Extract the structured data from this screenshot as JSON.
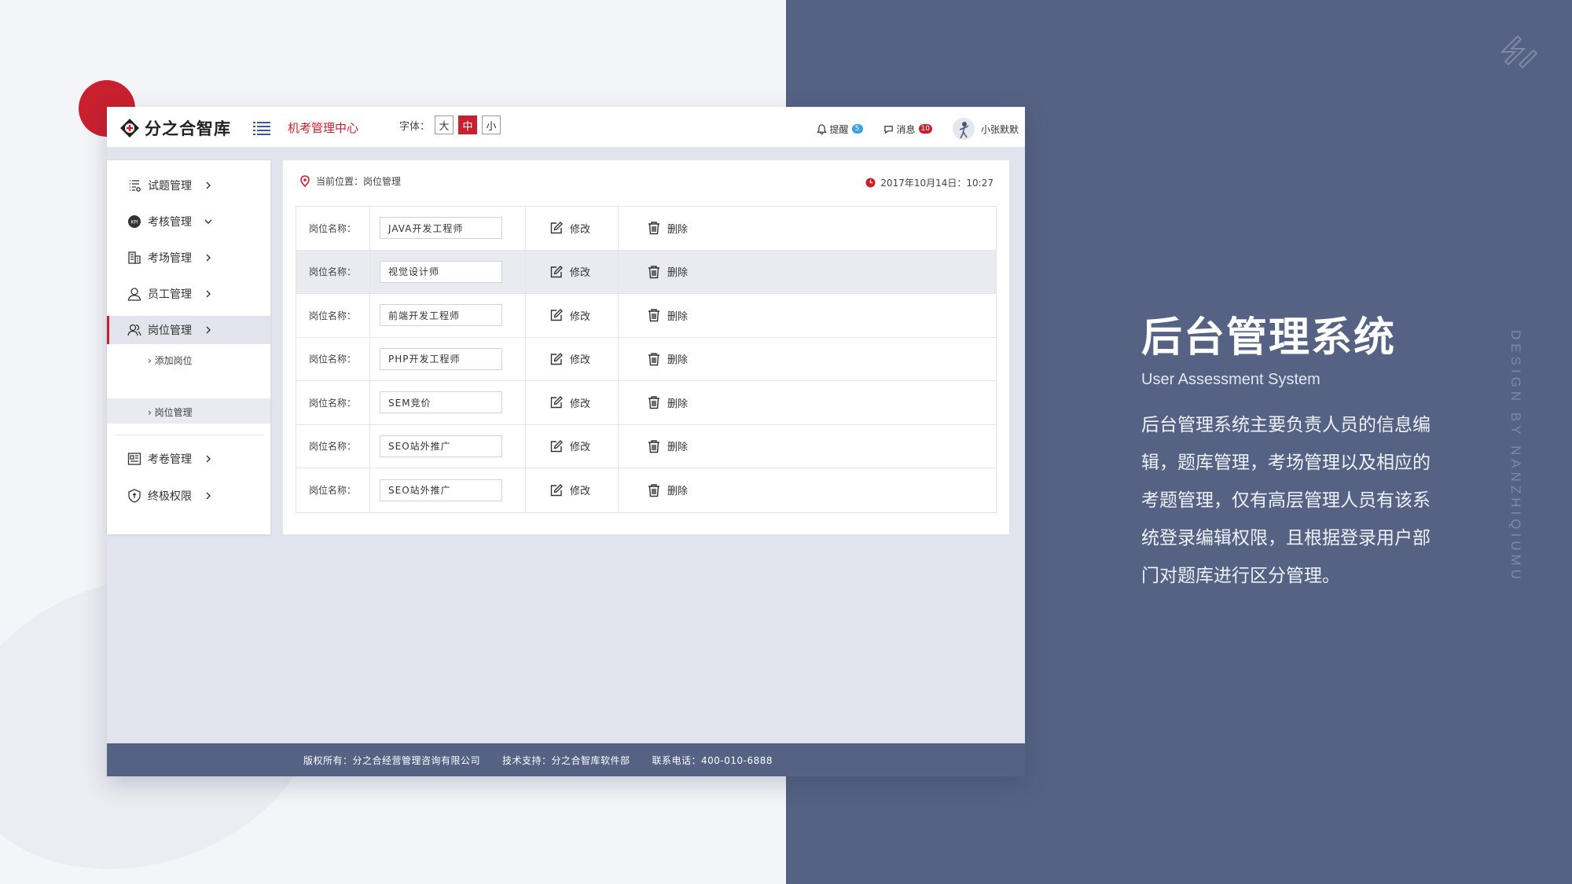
{
  "brand": {
    "name": "分之合智库"
  },
  "header": {
    "app_title": "机考管理中心",
    "font_label": "字体：",
    "font_sizes": [
      "大",
      "中",
      "小"
    ],
    "font_active": "中",
    "remind_label": "提醒",
    "remind_count": "5",
    "message_label": "消息",
    "message_count": "10",
    "username": "小张默默"
  },
  "sidebar": {
    "items": [
      {
        "label": "试题管理",
        "icon": "list-icon"
      },
      {
        "label": "考核管理",
        "icon": "kpi-icon"
      },
      {
        "label": "考场管理",
        "icon": "building-icon"
      },
      {
        "label": "员工管理",
        "icon": "user-icon"
      },
      {
        "label": "岗位管理",
        "icon": "users-icon"
      },
      {
        "label": "考卷管理",
        "icon": "paper-icon"
      },
      {
        "label": "终极权限",
        "icon": "shield-icon"
      }
    ],
    "sub_items": [
      "添加岗位",
      "岗位管理"
    ]
  },
  "content": {
    "breadcrumb": "当前位置：岗位管理",
    "datetime": "2017年10月14日：10:27",
    "row_label": "岗位名称：",
    "edit_label": "修改",
    "delete_label": "删除",
    "rows": [
      "JAVA开发工程师",
      "视觉设计师",
      "前端开发工程师",
      "PHP开发工程师",
      "SEM竞价",
      "SEO站外推广",
      "SEO站外推广"
    ]
  },
  "footer": {
    "copyright": "版权所有：分之合经营管理咨询有限公司",
    "support": "技术支持：分之合智库软件部",
    "phone": "联系电话：400-010-6888"
  },
  "promo": {
    "title": "后台管理系统",
    "subtitle": "User Assessment System",
    "description": "后台管理系统主要负责人员的信息编辑，题库管理，考场管理以及相应的考题管理，仅有高层管理人员有该系统登录编辑权限，且根据登录用户部门对题库进行区分管理。"
  },
  "vertical_text": "DESIGN BY NANZHIQIUMU",
  "colors": {
    "accent": "#c8202f",
    "panel": "#556283",
    "badge_blue": "#3aa3e3"
  }
}
